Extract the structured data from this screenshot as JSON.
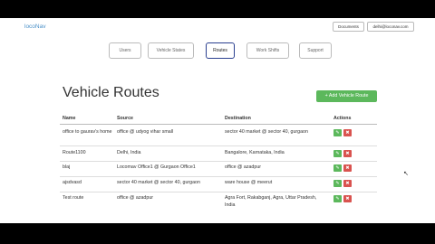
{
  "header": {
    "brand": "locoNav",
    "documents_label": "Documents",
    "user_label": "delhi@loconav.com"
  },
  "nav": {
    "users": "Users",
    "vehicle_states": "Vehicle States",
    "routes": "Routes",
    "work_shifts": "Work Shifts",
    "support": "Support"
  },
  "main": {
    "title": "Vehicle Routes",
    "add_button": "+ Add Vehicle Route"
  },
  "table": {
    "headers": {
      "name": "Name",
      "source": "Source",
      "destination": "Destination",
      "actions": "Actions"
    },
    "rows": [
      {
        "name": "office to gaurav's home",
        "source": "office @ udyog vihar small",
        "destination": "sector 40 market @ sector 40, gurgaon"
      },
      {
        "name": "Route1100",
        "source": "Delhi, India",
        "destination": "Bangalore, Karnataka, India"
      },
      {
        "name": "blaj",
        "source": "Locomav Office1 @ Gurgaon Office1",
        "destination": "office @ azadpur"
      },
      {
        "name": "ajsdvasd",
        "source": "sector 40 market @ sector 40, gurgaon",
        "destination": "ware house @ meerut"
      },
      {
        "name": "Test route",
        "source": "office @ azadpur",
        "destination": "Agra Fort, Rakabganj, Agra, Uttar Pradesh, India"
      }
    ]
  },
  "icons": {
    "edit": "pencil-icon",
    "delete": "times-icon"
  },
  "colors": {
    "brand": "#4a90c8",
    "success": "#5cb85c",
    "danger": "#d9534f",
    "active_nav_border": "#2a3f8f"
  }
}
